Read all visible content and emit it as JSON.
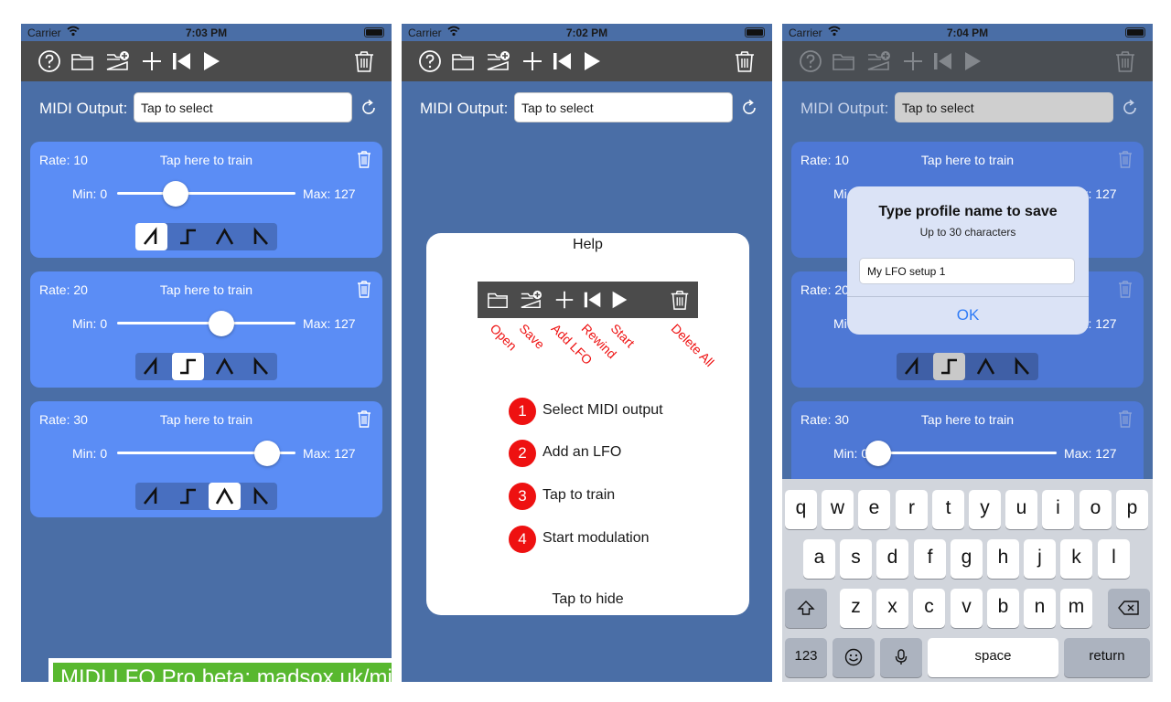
{
  "status": {
    "carrier": "Carrier",
    "times": [
      "7:03 PM",
      "7:02 PM",
      "7:04 PM"
    ]
  },
  "midi": {
    "label": "MIDI Output:",
    "placeholder": "Tap to select"
  },
  "lfos": [
    {
      "rate": "Rate: 10",
      "train": "Tap here to train",
      "min": "Min: 0",
      "max": "Max: 127",
      "value": 42,
      "shape": 0
    },
    {
      "rate": "Rate: 20",
      "train": "Tap here to train",
      "min": "Min: 0",
      "max": "Max: 127",
      "value": 74,
      "shape": 1
    },
    {
      "rate": "Rate: 30",
      "train": "Tap here to train",
      "min": "Min: 0",
      "max": "Max: 127",
      "value": 107,
      "shape": 2
    }
  ],
  "banner": "MIDI LFO Pro beta: madsox.uk/midi-beta",
  "help": {
    "title": "Help",
    "labels": [
      "Open",
      "Save",
      "Add LFO",
      "Rewind",
      "Start",
      "Delete All"
    ],
    "steps": [
      {
        "num": "1",
        "text": "Select MIDI output"
      },
      {
        "num": "2",
        "text": "Add an LFO"
      },
      {
        "num": "3",
        "text": "Tap to train"
      },
      {
        "num": "4",
        "text": "Start modulation"
      }
    ],
    "hide": "Tap to hide"
  },
  "phone3_lfos": [
    {
      "rate": "Rate: 10",
      "train": "Tap here to train",
      "max": "Max: 127",
      "min_partial": "Mi"
    },
    {
      "rate": "Rate: 20",
      "train": "Tap here to train",
      "max": "Max: 127",
      "min_partial": "Mi"
    },
    {
      "rate": "Rate: 30",
      "train": "Tap here to train",
      "min": "Min: 0",
      "max": "Max: 127",
      "value": 0
    }
  ],
  "alert": {
    "title": "Type profile name to save",
    "subtitle": "Up to 30 characters",
    "value": "My LFO setup 1",
    "ok": "OK"
  },
  "keyboard": {
    "row1": [
      "q",
      "w",
      "e",
      "r",
      "t",
      "y",
      "u",
      "i",
      "o",
      "p"
    ],
    "row2": [
      "a",
      "s",
      "d",
      "f",
      "g",
      "h",
      "j",
      "k",
      "l"
    ],
    "row3": [
      "z",
      "x",
      "c",
      "v",
      "b",
      "n",
      "m"
    ],
    "numbers": "123",
    "space": "space",
    "return": "return"
  },
  "colors": {
    "background": "#4a6ea6",
    "card": "#5b8df5",
    "toolbar": "#4b4b4b",
    "banner": "#58b82f",
    "help_red": "#ee1111",
    "ok_blue": "#2f7bf6"
  },
  "icons": [
    "help-icon",
    "folder-open-icon",
    "folder-add-icon",
    "plus-icon",
    "rewind-icon",
    "play-icon",
    "trash-icon",
    "refresh-icon",
    "wifi-icon",
    "battery-icon",
    "backspace-icon",
    "shift-icon",
    "emoji-icon",
    "microphone-icon"
  ]
}
